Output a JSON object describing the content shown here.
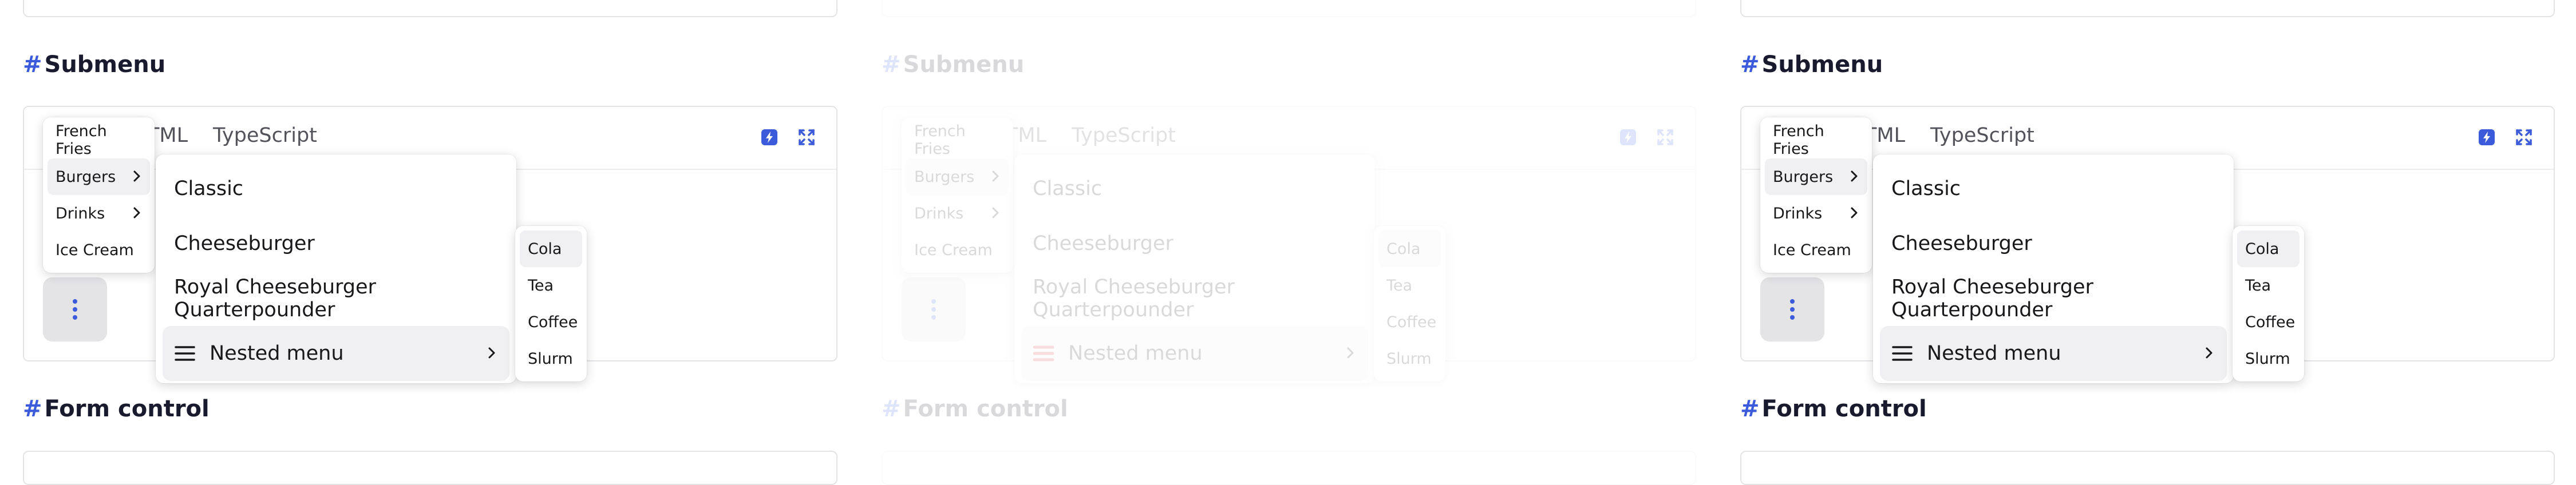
{
  "sections": {
    "submenu_title": "Submenu",
    "form_title": "Form control",
    "hash": "#"
  },
  "demo": {
    "tab_html": "TML",
    "tab_typescript": "TypeScript"
  },
  "menus": {
    "level1": [
      {
        "label": "French Fries",
        "has_submenu": false
      },
      {
        "label": "Burgers",
        "has_submenu": true
      },
      {
        "label": "Drinks",
        "has_submenu": true
      },
      {
        "label": "Ice Cream",
        "has_submenu": false
      }
    ],
    "level2": [
      {
        "label": "Classic"
      },
      {
        "label": "Cheeseburger"
      },
      {
        "label": "Royal Cheeseburger Quarterpounder"
      },
      {
        "label": "Nested menu",
        "icon": "hamburger-icon",
        "has_submenu": true
      }
    ],
    "level3": [
      {
        "label": "Cola"
      },
      {
        "label": "Tea"
      },
      {
        "label": "Coffee"
      },
      {
        "label": "Slurm"
      }
    ]
  },
  "colors": {
    "accent": "#3b5bdb",
    "heading": "#1a1a2e",
    "hover_bg": "#f0f0f2",
    "kebab_bg": "#e4e4e7",
    "icon_red_in_faded_frame": "#e03131"
  },
  "frames": {
    "faded_frame": "middle"
  }
}
